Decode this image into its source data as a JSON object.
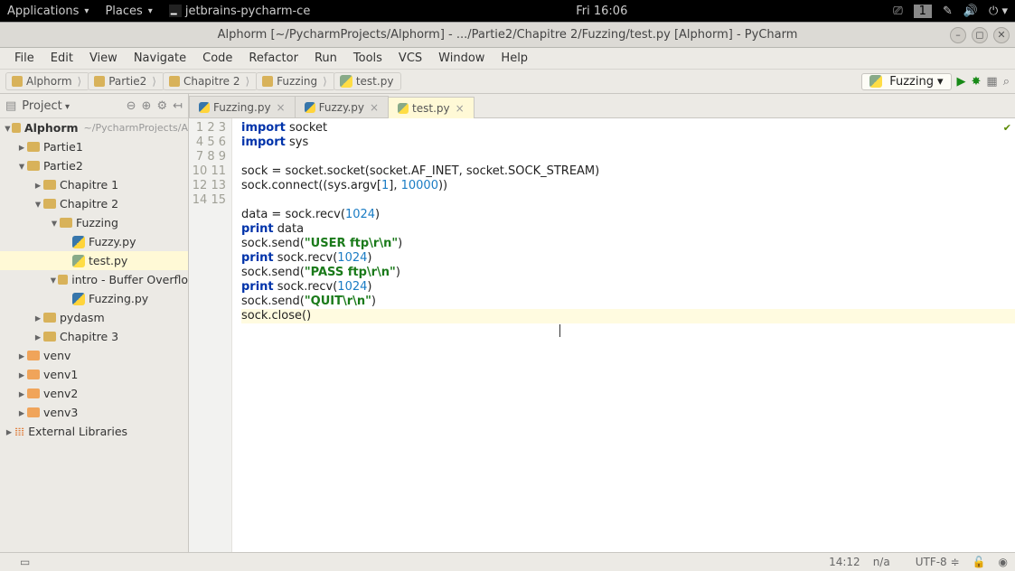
{
  "topbar": {
    "menus": [
      "Applications",
      "Places"
    ],
    "app_indicator": "jetbrains-pycharm-ce",
    "clock": "Fri 16:06",
    "workspace": "1"
  },
  "window": {
    "title": "Alphorm [~/PycharmProjects/Alphorm] - .../Partie2/Chapitre 2/Fuzzing/test.py [Alphorm] - PyCharm"
  },
  "menubar": [
    "File",
    "Edit",
    "View",
    "Navigate",
    "Code",
    "Refactor",
    "Run",
    "Tools",
    "VCS",
    "Window",
    "Help"
  ],
  "breadcrumbs": [
    "Alphorm",
    "Partie2",
    "Chapitre 2",
    "Fuzzing",
    "test.py"
  ],
  "run_config": "Fuzzing",
  "project_panel": {
    "label": "Project"
  },
  "project_root": {
    "name": "Alphorm",
    "hint": "~/PycharmProjects/A"
  },
  "tree": {
    "partie1": "Partie1",
    "partie2": "Partie2",
    "ch1": "Chapitre 1",
    "ch2": "Chapitre 2",
    "fuzzing": "Fuzzing",
    "fuzzy": "Fuzzy.py",
    "test": "test.py",
    "intro": "intro - Buffer Overflo",
    "fuzzingpy": "Fuzzing.py",
    "pydasm": "pydasm",
    "ch3": "Chapitre 3",
    "venv": "venv",
    "venv1": "venv1",
    "venv2": "venv2",
    "venv3": "venv3",
    "extlib": "External Libraries"
  },
  "tabs": [
    {
      "label": "Fuzzing.py",
      "active": false
    },
    {
      "label": "Fuzzy.py",
      "active": false
    },
    {
      "label": "test.py",
      "active": true
    }
  ],
  "code": {
    "lines": 15,
    "l1a": "import",
    "l1b": " socket",
    "l2a": "import",
    "l2b": " sys",
    "l4a": "sock = socket.socket(socket.AF_INET, socket.SOCK_STREAM)",
    "l5a": "sock.connect((sys.argv[",
    "l5n": "1",
    "l5b": "], ",
    "l5m": "10000",
    "l5c": "))",
    "l7a": "data = sock.recv(",
    "l7n": "1024",
    "l7b": ")",
    "l8a": "print",
    "l8b": " data",
    "l9a": "sock.send(",
    "l9s": "\"USER ftp\\r\\n\"",
    "l9b": ")",
    "l10a": "print",
    "l10b": " sock.recv(",
    "l10n": "1024",
    "l10c": ")",
    "l11a": "sock.send(",
    "l11s": "\"PASS ftp\\r\\n\"",
    "l11b": ")",
    "l12a": "print",
    "l12b": " sock.recv(",
    "l12n": "1024",
    "l12c": ")",
    "l13a": "sock.send(",
    "l13s": "\"QUIT\\r\\n\"",
    "l13b": ")",
    "l14a": "sock.close()"
  },
  "status": {
    "pos": "14:12",
    "sep": "n/a",
    "enc": "UTF-8"
  }
}
